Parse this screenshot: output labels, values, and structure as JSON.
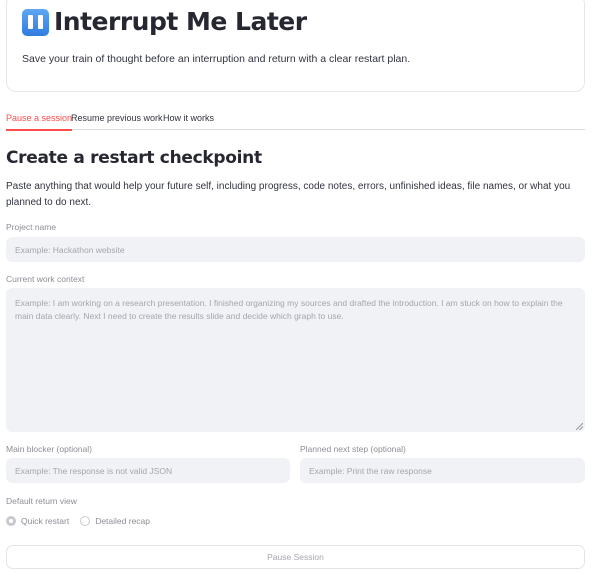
{
  "header": {
    "title": "Interrupt Me Later",
    "icon": "pause-icon",
    "subtitle": "Save your train of thought before an interruption and return with a clear restart plan."
  },
  "tabs": [
    {
      "label": "Pause a session",
      "active": true
    },
    {
      "label": "Resume previous work",
      "active": false
    },
    {
      "label": "How it works",
      "active": false
    }
  ],
  "form": {
    "title": "Create a restart checkpoint",
    "intro": "Paste anything that would help your future self, including progress, code notes, errors, unfinished ideas, file names, or what you planned to do next.",
    "project_name": {
      "label": "Project name",
      "placeholder": "Example: Hackathon website",
      "value": ""
    },
    "context": {
      "label": "Current work context",
      "placeholder": "Example: I am working on a research presentation. I finished organizing my sources and drafted the introduction. I am stuck on how to explain the main data clearly. Next I need to create the results slide and decide which graph to use.",
      "value": ""
    },
    "blocker": {
      "label": "Main blocker (optional)",
      "placeholder": "Example: The response is not valid JSON",
      "value": ""
    },
    "next_step": {
      "label": "Planned next step (optional)",
      "placeholder": "Example: Print the raw response",
      "value": ""
    },
    "return_view": {
      "label": "Default return view",
      "options": [
        "Quick restart",
        "Detailed recap"
      ],
      "selected": "Quick restart"
    },
    "submit_label": "Pause Session"
  },
  "colors": {
    "accent": "#ff4b4b",
    "field_bg": "#f0f2f6",
    "muted_text": "#8c8e95"
  }
}
